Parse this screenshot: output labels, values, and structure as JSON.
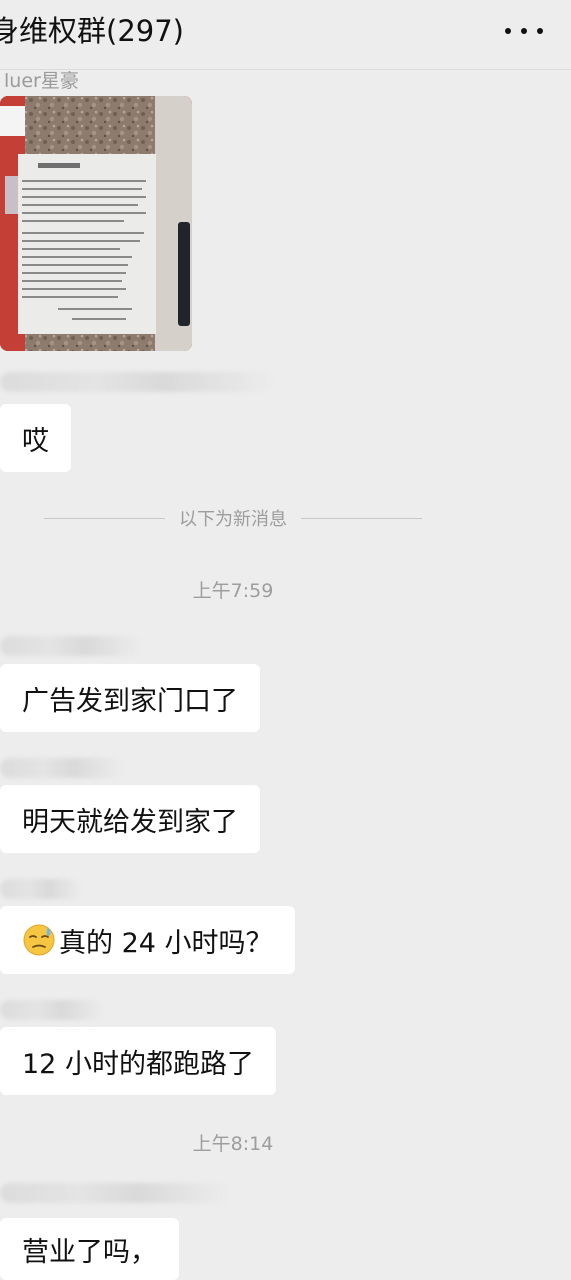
{
  "header": {
    "title": "身维权群(297)",
    "more_icon": "more-dots-icon"
  },
  "messages": {
    "photo_sender": "luer星豪",
    "photo_notice_title": "业主通知",
    "msg1": "哎",
    "new_messages_divider": "以下为新消息",
    "time1": "上午7:59",
    "msg2": "广告发到家门口了",
    "msg3": "明天就给发到家了",
    "msg4_emoji": "sweat-smile-emoji",
    "msg4_text": "真的 24 小时吗？",
    "msg5": "12 小时的都跑路了",
    "time2": "上午8:14",
    "msg6": "营业了吗，"
  },
  "colors": {
    "background": "#ededed",
    "bubble": "#ffffff",
    "secondary_text": "#9d9d9d"
  }
}
